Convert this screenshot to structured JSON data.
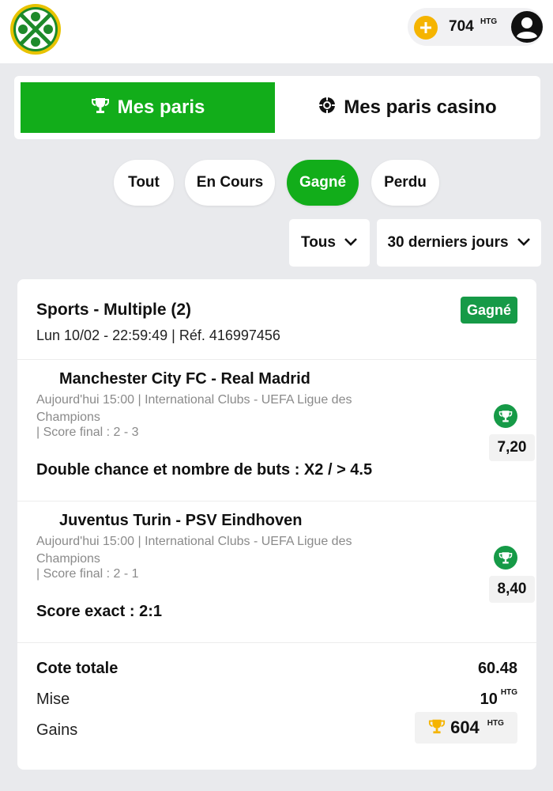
{
  "colors": {
    "brand_green": "#12ad1a",
    "badge_green": "#169a47",
    "coin_yellow": "#f5b400",
    "background": "#e9eaed"
  },
  "header": {
    "logo_icon": "sports-ball-logo-icon",
    "add_funds_icon": "plus-circle-icon",
    "balance": "704",
    "currency": "HTG",
    "profile_icon": "user-avatar-icon"
  },
  "tabs": {
    "sports": {
      "label": "Mes paris",
      "icon": "trophy-icon",
      "active": true
    },
    "casino": {
      "label": "Mes paris casino",
      "icon": "chip-icon",
      "active": false
    }
  },
  "filters": [
    {
      "label": "Tout",
      "active": false
    },
    {
      "label": "En Cours",
      "active": false
    },
    {
      "label": "Gagné",
      "active": true
    },
    {
      "label": "Perdu",
      "active": false
    }
  ],
  "dropdowns": {
    "type": {
      "value": "Tous",
      "icon": "chevron-down-icon"
    },
    "period": {
      "value": "30 derniers jours",
      "icon": "chevron-down-icon"
    }
  },
  "bet": {
    "title": "Sports - Multiple (2)",
    "meta": "Lun 10/02 - 22:59:49 | Réf. 416997456",
    "status": "Gagné",
    "selections": [
      {
        "match": "Manchester City FC - Real Madrid",
        "info": "Aujourd'hui 15:00 |  International Clubs  -  UEFA Ligue des Champions",
        "final_score": " | Score final : 2 - 3",
        "odd": "7,20",
        "market": "Double chance et nombre de buts : X2 / > 4.5",
        "result_icon": "trophy-icon"
      },
      {
        "match": "Juventus Turin - PSV Eindhoven",
        "info": "Aujourd'hui 15:00 |  International Clubs  -  UEFA Ligue des Champions",
        "final_score": " | Score final : 2 - 1",
        "odd": "8,40",
        "market": "Score exact : 2:1",
        "result_icon": "trophy-icon"
      }
    ],
    "summary": {
      "total_odds_label": "Cote totale",
      "total_odds": "60.48",
      "stake_label": "Mise",
      "stake": "10",
      "gains_label": "Gains",
      "gains": "604",
      "currency": "HTG"
    }
  }
}
